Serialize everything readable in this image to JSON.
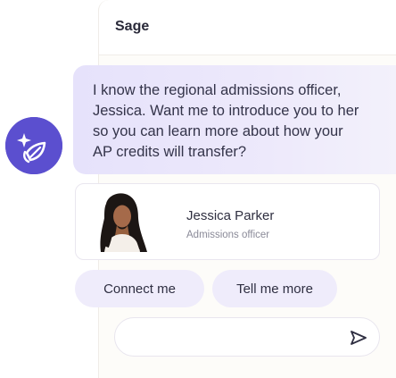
{
  "header": {
    "title": "Sage"
  },
  "assistant": {
    "message": "I know the regional admissions officer, Jessica. Want me to introduce you to her so you can learn more about how your AP credits will transfer?"
  },
  "contact": {
    "name": "Jessica Parker",
    "role": "Admissions officer"
  },
  "actions": {
    "connect_label": "Connect me",
    "more_label": "Tell me more"
  },
  "composer": {
    "placeholder": ""
  },
  "colors": {
    "accent": "#5b4fcf",
    "bubble": "#e9e6fb",
    "chip": "#efecfb"
  }
}
